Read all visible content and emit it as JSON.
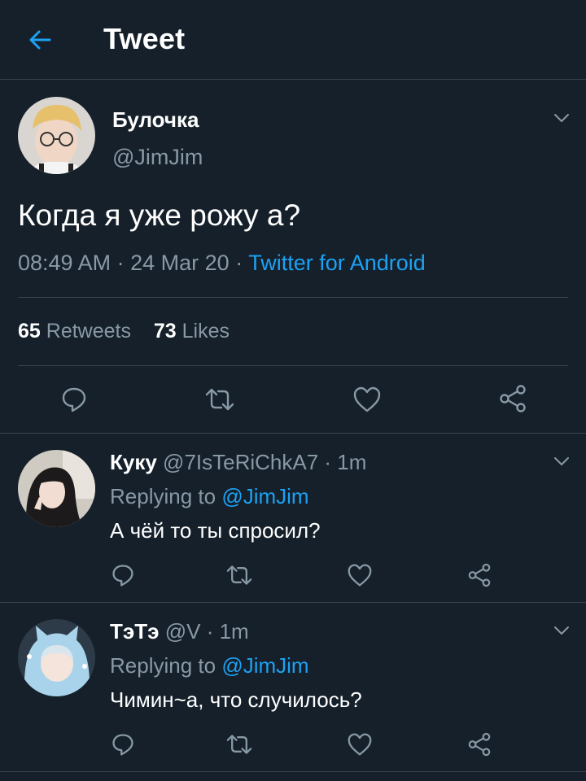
{
  "header": {
    "back_icon": "arrow-left-icon",
    "title": "Tweet"
  },
  "tweet": {
    "author_name": "Булочка",
    "author_handle": "@JimJim",
    "text": "Когда я уже рожу а?",
    "time": "08:49 AM",
    "date": "24 Mar 20",
    "source": "Twitter for Android",
    "retweets_count": "65",
    "retweets_label": "Retweets",
    "likes_count": "73",
    "likes_label": "Likes"
  },
  "replies": [
    {
      "name": "Куку",
      "handle": "@7IsTeRiChkA7",
      "time": "1m",
      "replying_prefix": "Replying to",
      "replying_to": "@JimJim",
      "text": "А чёй то ты спросил?"
    },
    {
      "name": "ТэТэ",
      "handle": "@V",
      "time": "1m",
      "replying_prefix": "Replying to",
      "replying_to": "@JimJim",
      "text": "Чимин~а, что случилось?"
    }
  ],
  "colors": {
    "background": "#15202b",
    "accent": "#1da1f2",
    "secondary_text": "#8899a6",
    "divider": "#38444d"
  },
  "icons": [
    "arrow-left-icon",
    "chevron-down-icon",
    "reply-icon",
    "retweet-icon",
    "heart-icon",
    "share-icon"
  ]
}
